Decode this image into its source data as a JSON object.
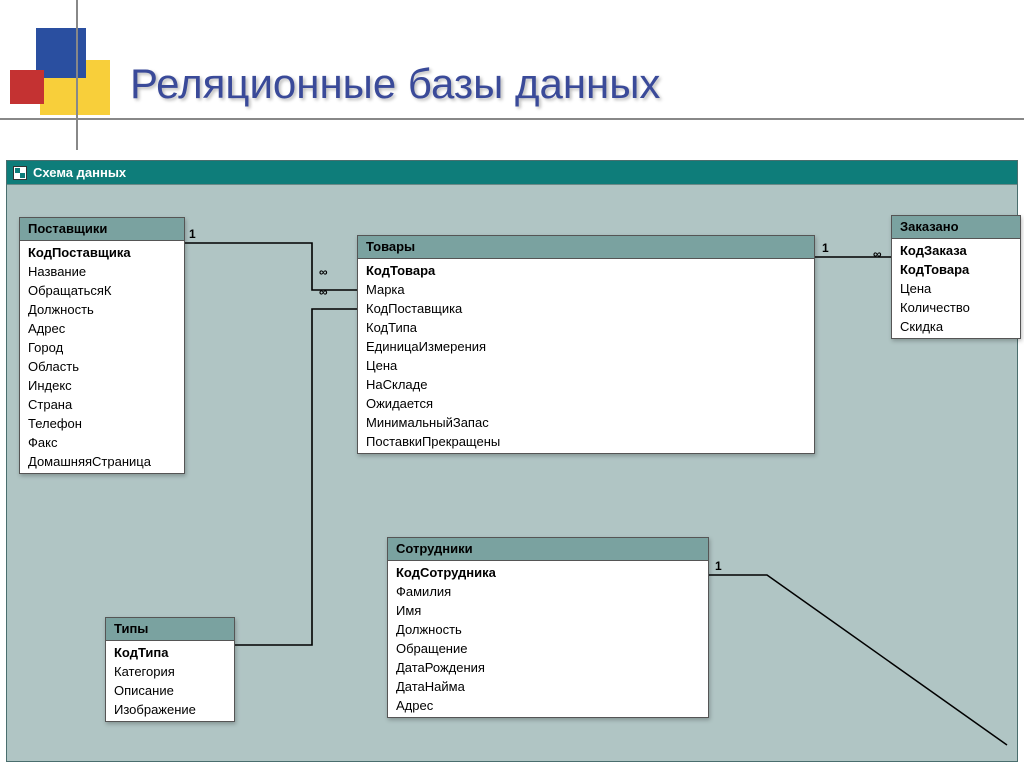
{
  "slide": {
    "title": "Реляционные базы данных"
  },
  "window": {
    "title": "Схема данных"
  },
  "tables": {
    "suppliers": {
      "title": "Поставщики",
      "fields": [
        {
          "name": "КодПоставщика",
          "key": true
        },
        {
          "name": "Название",
          "key": false
        },
        {
          "name": "ОбращатьсяК",
          "key": false
        },
        {
          "name": "Должность",
          "key": false
        },
        {
          "name": "Адрес",
          "key": false
        },
        {
          "name": "Город",
          "key": false
        },
        {
          "name": "Область",
          "key": false
        },
        {
          "name": "Индекс",
          "key": false
        },
        {
          "name": "Страна",
          "key": false
        },
        {
          "name": "Телефон",
          "key": false
        },
        {
          "name": "Факс",
          "key": false
        },
        {
          "name": "ДомашняяСтраница",
          "key": false
        }
      ]
    },
    "products": {
      "title": "Товары",
      "fields": [
        {
          "name": "КодТовара",
          "key": true
        },
        {
          "name": "Марка",
          "key": false
        },
        {
          "name": "КодПоставщика",
          "key": false
        },
        {
          "name": "КодТипа",
          "key": false
        },
        {
          "name": "ЕдиницаИзмерения",
          "key": false
        },
        {
          "name": "Цена",
          "key": false
        },
        {
          "name": "НаСкладе",
          "key": false
        },
        {
          "name": "Ожидается",
          "key": false
        },
        {
          "name": "МинимальныйЗапас",
          "key": false
        },
        {
          "name": "ПоставкиПрекращены",
          "key": false
        }
      ]
    },
    "ordered": {
      "title": "Заказано",
      "fields": [
        {
          "name": "КодЗаказа",
          "key": true
        },
        {
          "name": "КодТовара",
          "key": true
        },
        {
          "name": "Цена",
          "key": false
        },
        {
          "name": "Количество",
          "key": false
        },
        {
          "name": "Скидка",
          "key": false
        }
      ]
    },
    "types": {
      "title": "Типы",
      "fields": [
        {
          "name": "КодТипа",
          "key": true
        },
        {
          "name": "Категория",
          "key": false
        },
        {
          "name": "Описание",
          "key": false
        },
        {
          "name": "Изображение",
          "key": false
        }
      ]
    },
    "employees": {
      "title": "Сотрудники",
      "fields": [
        {
          "name": "КодСотрудника",
          "key": true
        },
        {
          "name": "Фамилия",
          "key": false
        },
        {
          "name": "Имя",
          "key": false
        },
        {
          "name": "Должность",
          "key": false
        },
        {
          "name": "Обращение",
          "key": false
        },
        {
          "name": "ДатаРождения",
          "key": false
        },
        {
          "name": "ДатаНайма",
          "key": false
        },
        {
          "name": "Адрес",
          "key": false
        }
      ]
    }
  },
  "relation_labels": {
    "one": "1",
    "many": "∞"
  }
}
